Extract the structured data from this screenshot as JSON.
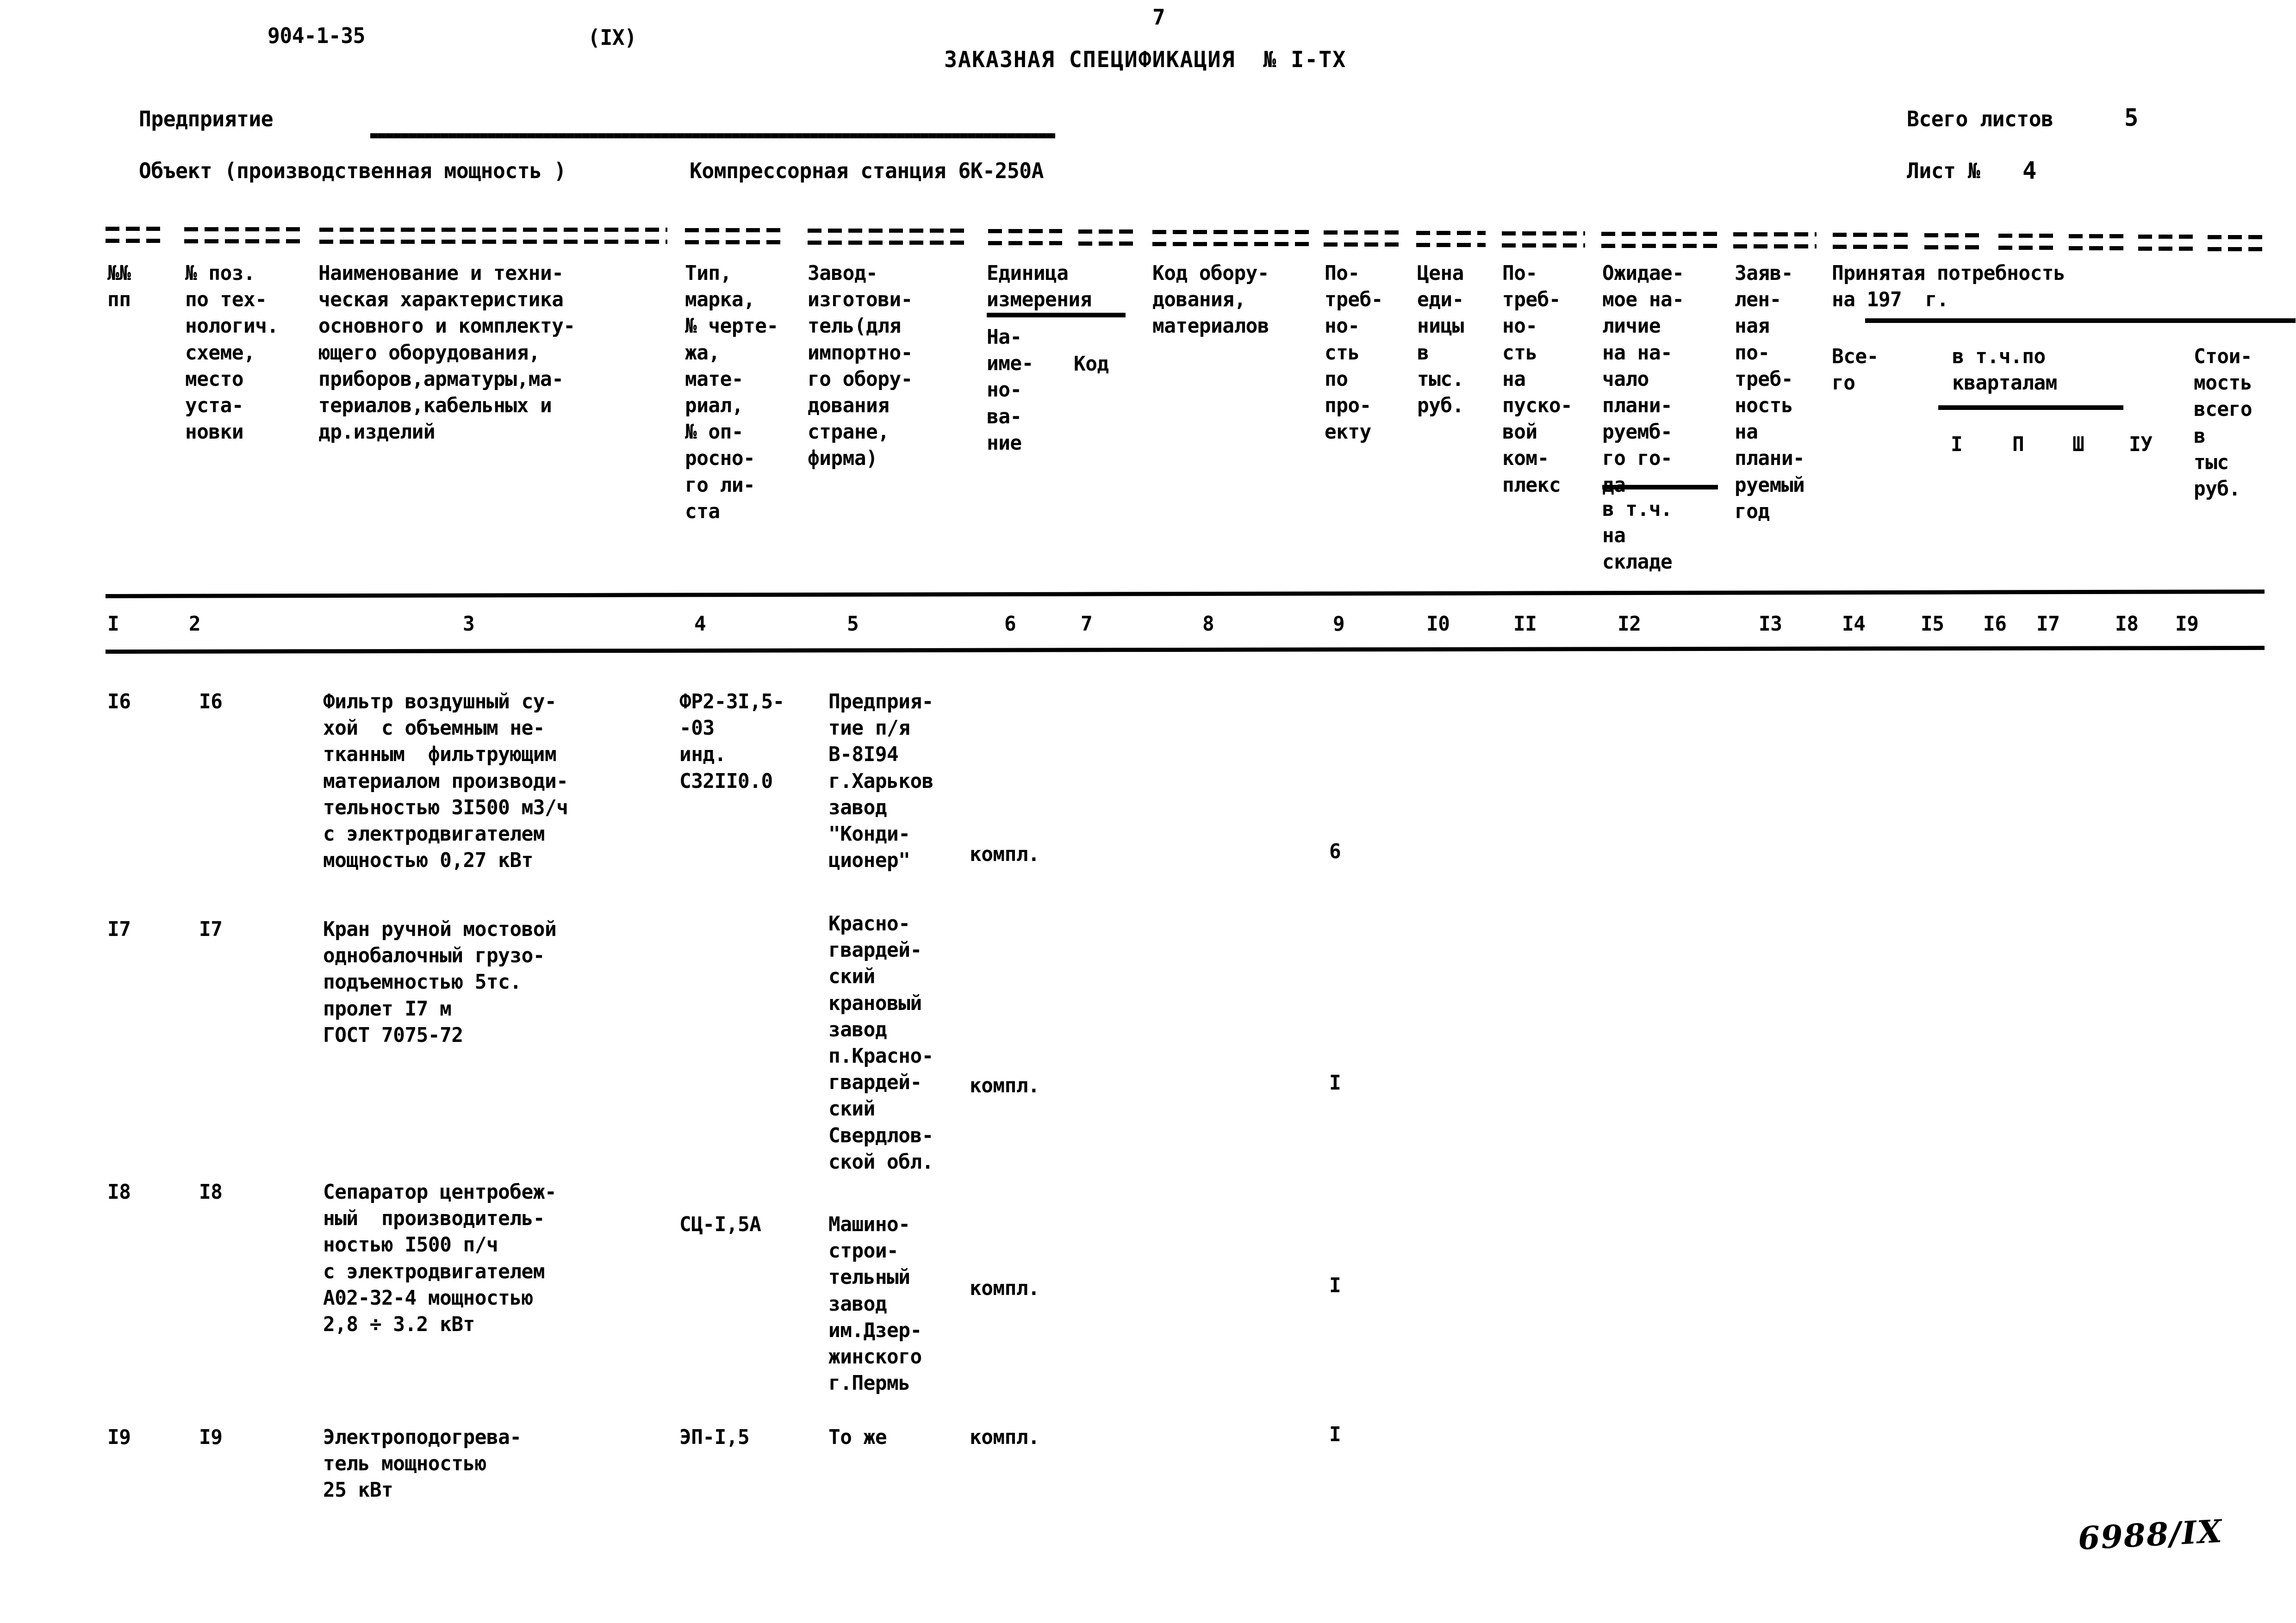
{
  "page": {
    "doc_code": "904-1-35",
    "series": "(IX)",
    "page_number": "7",
    "title": "ЗАКАЗНАЯ СПЕЦИФИКАЦИЯ  № I-ТХ",
    "hand_annotation": "6988/IX"
  },
  "meta": {
    "enterprise_label": "Предприятие",
    "enterprise_value": "",
    "object_label": "Объект (производственная мощность )",
    "object_value": "Компрессорная станция 6К-250А",
    "total_sheets_label": "Всего листов",
    "total_sheets_value": "5",
    "sheet_label": "Лист №",
    "sheet_value": "4"
  },
  "headers": {
    "c1": [
      "№№",
      "пп"
    ],
    "c2": [
      "№ поз.",
      "по тех-",
      "нологич.",
      "схеме,",
      "место",
      "уста-",
      "новки"
    ],
    "c3": [
      "Наименование и техни-",
      "ческая характеристика",
      "основного и комплекту-",
      "ющего оборудования,",
      "приборов,арматуры,ма-",
      "териалов,кабельных и",
      "др.изделий"
    ],
    "c4": [
      "Тип,",
      "марка,",
      "№ черте-",
      "жа,",
      "мате-",
      "риал,",
      "№ оп-",
      "росно-",
      "го ли-",
      "ста"
    ],
    "c5": [
      "Завод-",
      "изготови-",
      "тель(для",
      "импортно-",
      "го обору-",
      "дования",
      "стране,",
      "фирма)"
    ],
    "c6_group": [
      "Единица",
      "измерения"
    ],
    "c6": [
      "На-",
      "име-",
      "но-",
      "ва-",
      "ние"
    ],
    "c7": [
      "Код"
    ],
    "c8_group": [
      "Код обору-",
      "дования,",
      "материалов"
    ],
    "c9": [
      "По-",
      "треб-",
      "но-",
      "сть",
      "по",
      "про-",
      "екту"
    ],
    "c10": [
      "Цена",
      "еди-",
      "ницы",
      "в",
      "тыс.",
      "руб."
    ],
    "c11": [
      "По-",
      "треб-",
      "но-",
      "сть",
      "на",
      "пуско-",
      "вой",
      "ком-",
      "плекс"
    ],
    "c12": [
      "Ожидае-",
      "мое на-",
      "личие",
      "на на-",
      "чало",
      "плани-",
      "руемб-",
      "го го-",
      "да"
    ],
    "c12b": [
      "в т.ч.",
      "на",
      "складе"
    ],
    "c13": [
      "Заяв-",
      "лен-",
      "ная",
      "по-",
      "треб-",
      "ность",
      "на",
      "плани-",
      "руемый",
      "год"
    ],
    "c14_group": [
      "Принятая потребность",
      "на 197  г."
    ],
    "c14": [
      "Все-",
      "го"
    ],
    "c15_group": [
      "в т.ч.по",
      "кварталам"
    ],
    "quarters": [
      "I",
      "П",
      "Ш",
      "IУ"
    ],
    "c19": [
      "Стои-",
      "мость",
      "всего",
      "в",
      "тыс",
      "руб."
    ]
  },
  "column_numbers": [
    "I",
    "2",
    "3",
    "4",
    "5",
    "6",
    "7",
    "8",
    "9",
    "I0",
    "II",
    "I2",
    "I3",
    "I4",
    "I5",
    "I6",
    "I7",
    "I8",
    "I9"
  ],
  "rows": [
    {
      "nn": "I6",
      "pos": "I6",
      "name": [
        "Фильтр воздушный су-",
        "хой  с объемным не-",
        "тканным  фильтрующим",
        "материалом производи-",
        "тельностью 3I500 м3/ч",
        "с электродвигателем",
        "мощностью 0,27 кВт"
      ],
      "type": [
        "ФР2-3I,5-",
        "-03",
        "инд.",
        "С32II0.0"
      ],
      "plant": [
        "Предприя-",
        "тие п/я",
        "В-8I94",
        "г.Харьков",
        "завод",
        "\"Конди-",
        "ционер\""
      ],
      "unit": "компл.",
      "qty": "6"
    },
    {
      "nn": "I7",
      "pos": "I7",
      "name": [
        "Кран ручной мостовой",
        "однобалочный грузо-",
        "подъемностью 5тс.",
        "пролет I7 м",
        "ГОСТ 7075-72"
      ],
      "type": [],
      "plant": [
        "Красно-",
        "гвардей-",
        "ский",
        "крановый",
        "завод",
        "п.Красно-",
        "гвардей-",
        "ский",
        "Свердлов-",
        "ской обл."
      ],
      "unit": "компл.",
      "qty": "I"
    },
    {
      "nn": "I8",
      "pos": "I8",
      "name": [
        "Сепаратор центробеж-",
        "ный  производитель-",
        "ностью I500 п/ч",
        "с электродвигателем",
        "А02-32-4 мощностью",
        "2,8 ÷ 3.2 кВт"
      ],
      "type": [
        "СЦ-I,5А"
      ],
      "plant": [
        "Машино-",
        "строи-",
        "тельный",
        "завод",
        "им.Дзер-",
        "жинского",
        "г.Пермь"
      ],
      "unit": "компл.",
      "qty": "I"
    },
    {
      "nn": "I9",
      "pos": "I9",
      "name": [
        "Электроподогрева-",
        "тель мощностью",
        "25 кВт"
      ],
      "type": [
        "ЭП-I,5"
      ],
      "plant": [
        "То же"
      ],
      "unit": "компл.",
      "qty": "I"
    }
  ]
}
